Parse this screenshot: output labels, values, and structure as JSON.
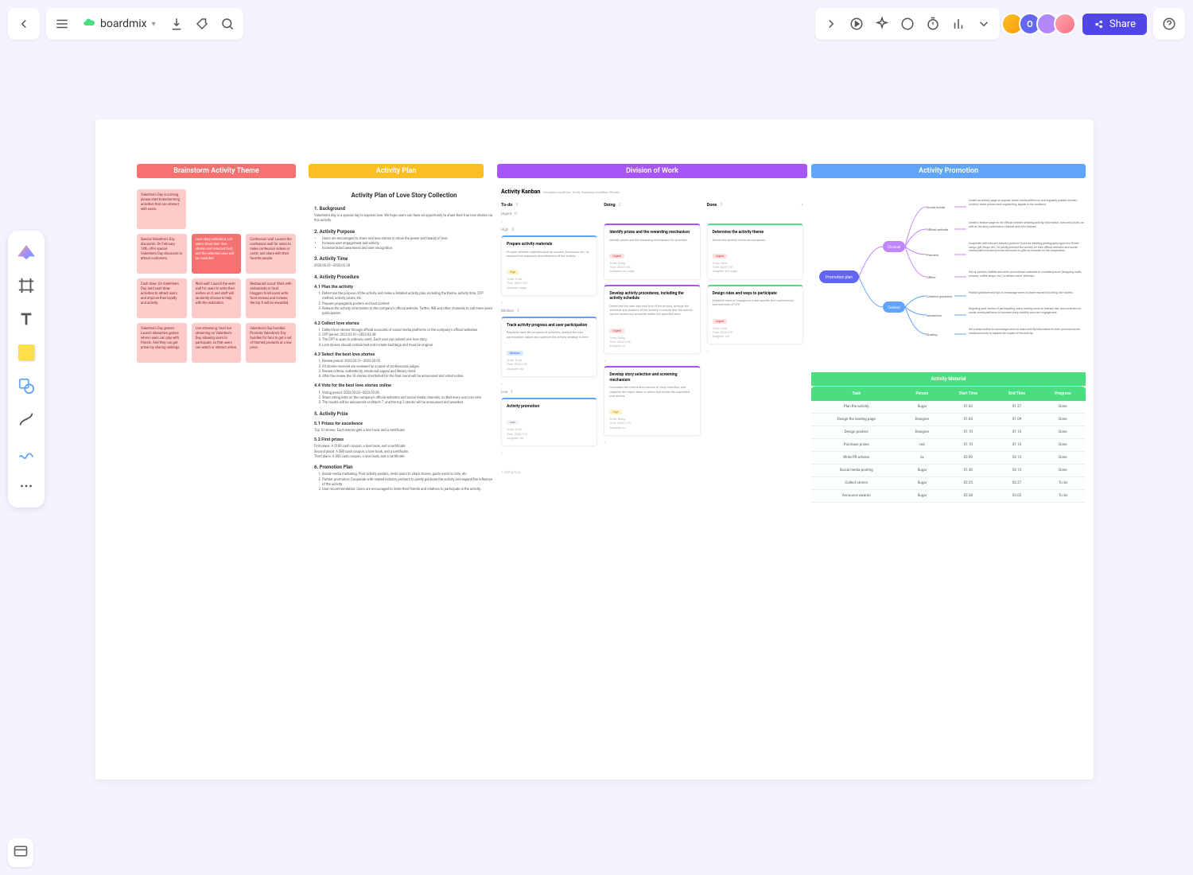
{
  "doc_name": "boardmix",
  "share_label": "Share",
  "avatar_initial": "O",
  "left_tools": [
    "select",
    "frame",
    "text",
    "sticky",
    "shape",
    "connector",
    "pencil",
    "more"
  ],
  "sections": {
    "s1": "Brainstorm Activity Theme",
    "s2": "Activity Plan",
    "s3": "Division of Work",
    "s4": "Activity Promotion"
  },
  "brainstorm": {
    "row0": "Valentine's Day is coming, please start brainstorming activities that can interact with users.",
    "rows": [
      [
        "Special Valentine's Day discounts: On February 14th, offer special Valentine's Day discounts to attract customers.",
        "Love story collection: Let users share their love stories and selected best, and the selected ones will be rewarded.",
        "Confession wall: Launch the confession wall for users to make confession videos or cards, and share with their favorite people."
      ],
      [
        "Cash draw: On Valentine's Day, hold cash draw activities to attract users and improve their loyalty and activity.",
        "Wish wall: Launch the wish wall for users to write their wishes on it, and staff will randomly choose to help with the realization.",
        "Restaurant scout: Work with restaurants or food bloggers to let users write food reviews and reviews, the top X will be rewarded."
      ],
      [
        "Valentine's Day games: Launch interactive games where users can play with friends. And they can get prizes by sharing rankings.",
        "Live streaming: Host live streaming on Valentine's Day, allowing users to participate, so that users can watch or interact online.",
        "Valentine's Day bundles: Promote Valentine's Day bundles for fans to get a set of themed products at a low price."
      ]
    ]
  },
  "plan": {
    "title": "Activity Plan of Love Story Collection",
    "h1": "1. Background",
    "p1": "Valentine's day is a special day to express love. We hope users can have an opportunity to share their true love stories via this activity.",
    "h2": "2. Activity Purpose",
    "l2a": "Users are encouraged to share real love stories to show the power and beauty of love.",
    "l2b": "Increase user engagement and activity.",
    "l2c": "Increase brand awareness and user recognition.",
    "h3": "3. Activity Time",
    "p3": "2023.02.01~2023.02.28",
    "h4": "4. Activity Procedure",
    "h41": "4.1 Plan the activity",
    "l41a": "Determine the purpose of the activity and make a detailed activity plan, including the theme, activity time, CFP method, activity prizes, etc.",
    "l41b": "Prepare propaganda posters and text content.",
    "l41c": "Release the activity information to the company's official website, Twitter, INS and other channels to call more users' participation.",
    "h42": "4.2 Collect love stories",
    "l42a": "Collect love stories through official accounts of social media platforms or the company's official websites.",
    "l42b": "CFP period: 2023.02.01~2023.02.28.",
    "l42c": "The CFP is open to ordinary users. Each user can submit one love story.",
    "l42d": "Love stories should contain text and include hashtags and must be original.",
    "h43": "4.3 Select the best love stories",
    "l43a": "Review period: 2023.03.01~2023.03.03",
    "l43b": "All stories received are reviewed by a panel of professional judges.",
    "l43c": "Review criteria: authenticity, emotional appeal and literary merit.",
    "l43d": "After the review, the 10 stories shortlisted for the final round will be announced and voted online.",
    "h44": "4.4 Vote for the best love stories online",
    "l44a": "Voting period: 2023.03.03~2023.03.06",
    "l44b": "Share voting links on the company's official websites and social media channels, so that every user can vote.",
    "l44c": "The results will be announced on March 7, and the top 3 stories will be announced and awarded.",
    "h5": "5. Activity Prize",
    "h51": "5.1 Prizes for excellence",
    "p51": "Top 10 stories. Each winner gets a love book and a certificate.",
    "h52": "5.2 First prizes",
    "p52a": "First place: A $100 cash coupon, a love book, and a certificate.",
    "p52b": "Second place: A $80 cash coupon, a love book, and a certificate.",
    "p52c": "Third place: A $50 cash coupon, a love book, and a certificate.",
    "h6": "6. Promotion Plan",
    "l6a": "Social media marketing: Post activity posters, invite users to share stories, guide users to vote, etc.",
    "l6b": "Partner promotion: Cooperate with related industry partners to jointly publicize the activity and expand the influence of the activity.",
    "l6c": "User recommendation: Users are encouraged to invite their friends and relatives to participate in the activity."
  },
  "kanban": {
    "title": "Activity Kanban",
    "sub": "Grouping condition: To-do, Grouping condition: Priority",
    "cols": [
      "To-do",
      "Doing",
      "Done"
    ],
    "counts": [
      "5",
      "2",
      "3"
    ],
    "prio_urgent": "Urgent",
    "prio_high": "High",
    "prio_medium": "Medium",
    "prio_low": "Low",
    "cards": {
      "c1": {
        "t": "Identify prizes and the rewarding mechanism",
        "d": "Identify prizes and the rewarding mechanism for activities.",
        "tag": "Urgent",
        "meta": [
          "To-do: Doing",
          "Time: 2023/1/03",
          "Assignee: red, sugar"
        ]
      },
      "c2": {
        "t": "Develop activity procedures, including the activity schedule",
        "d": "Determine the start and end time of the activity, arrange the schedule and duration of the activity to ensure that the activity can be carried out smoothly within the specified time.",
        "tag": "Urgent",
        "meta": [
          "To-do: Doing",
          "Time: 2023/1/08",
          "Assignee: xx"
        ]
      },
      "c3": {
        "t": "Determine the activity theme",
        "d": "Decide the activity theme and purposes.",
        "tag": "Urgent",
        "meta": [
          "To-do: Done",
          "Time: 2023/1/01",
          "Assignee: red, sugar"
        ]
      },
      "c4": {
        "t": "Design rules and ways to participate",
        "d": "Establish rules of engagement and specific the requirements and methods of CFP.",
        "tag": "Urgent",
        "meta": [
          "To-do: Done",
          "Time: 2023/1/07",
          "Assignee: red"
        ]
      },
      "c5": {
        "t": "Prepare activity materials",
        "d": "Prepare relevant materials such as posters, brochures, etc., to enhance the popularity and attraction of the activity.",
        "tag": "High",
        "meta": [
          "To-do: To-do",
          "Time: 2023/1/09",
          "Assignee: sugar"
        ]
      },
      "c6": {
        "t": "Develop story selection and screening mechanism",
        "d": "Formulate the criteria and process of story selection, and organize the expert team to select and review the submitted love stories.",
        "tag": "High",
        "meta": [
          "To-do: Doing",
          "Time: 2023/1/10",
          "Assignee: xx"
        ]
      },
      "c7": {
        "t": "Track activity progress and user participation",
        "d": "Regularly track the progress of activities, analyze the user participation, adjust and optimize the activity strategy in time.",
        "tag": "Medium",
        "meta": [
          "To-do: To-do",
          "Time: 2023/1/20",
          "Assignee: red"
        ]
      },
      "c8": {
        "t": "Activity promotion",
        "tag": "Low",
        "meta": [
          "To-do: To-do",
          "Time: 2023/1/15",
          "Assignee: red"
        ]
      }
    },
    "add": "+",
    "addgroup": "+ Add group"
  },
  "mindmap": {
    "root": "Promotion plan",
    "branches": [
      {
        "name": "Channel",
        "color": "ch",
        "items": [
          {
            "k": "Social media",
            "v": "Create an activity page on popular social media platforms, and regularly publish relevant content, share posters and copywriting, appeal to the audience."
          },
          {
            "k": "Official website",
            "v": "Create a feature page on the official website detailing activity information, rules and prizes, as well as the story submission channel and vote channel."
          },
          {
            "k": "Partners",
            "v": "Cooperate with relevant industry partners (such as wedding photography agencies, flower shops, gift shops, etc.) to jointly promote the activity on their official websites and social media platforms and provide discounts or gifts as rewards for the cooperation."
          },
          {
            "k": "Offline",
            "v": "Put up posters, leaflets and other promotional materials in crowded places (shopping malls, schools, coffee shops, etc.) to attract users' attention."
          }
        ]
      },
      {
        "name": "Content",
        "color": "cn",
        "items": [
          {
            "k": "Creation guidance",
            "v": "Publish guidance and tips to encourage users to share real and touching love stories."
          },
          {
            "k": "Interaction",
            "v": "Regularly post stories of participating users, leading users to interact, like, and comment on social media platforms to increase story visibility and user engagement."
          },
          {
            "k": "Sharing",
            "v": "Set a share button to encourage users to share activity information to their personal social media accounts to expand the impact of the activity."
          }
        ]
      }
    ]
  },
  "table": {
    "title": "Activity Material",
    "headers": [
      "Task",
      "Person",
      "Start Time",
      "End Time",
      "Progress"
    ],
    "rows": [
      [
        "Plan the activity",
        "Sugar",
        "01.03",
        "01.27",
        "Done"
      ],
      [
        "Design the landing page",
        "Designer",
        "01.04",
        "01.09",
        "Done"
      ],
      [
        "Design posters",
        "Designer",
        "01.10",
        "01.10",
        "Done"
      ],
      [
        "Purchase prizes",
        "red",
        "01.10",
        "01.10",
        "Done"
      ],
      [
        "Write PR articles",
        "xx",
        "02.09",
        "02.13",
        "Done"
      ],
      [
        "Social media posting",
        "Sugar",
        "01.30",
        "02.13",
        "Done"
      ],
      [
        "Collect stories",
        "Sugar",
        "02.25",
        "02.27",
        "To do"
      ],
      [
        "Announce awards",
        "Sugar",
        "02.28",
        "03.02",
        "To do"
      ]
    ]
  }
}
